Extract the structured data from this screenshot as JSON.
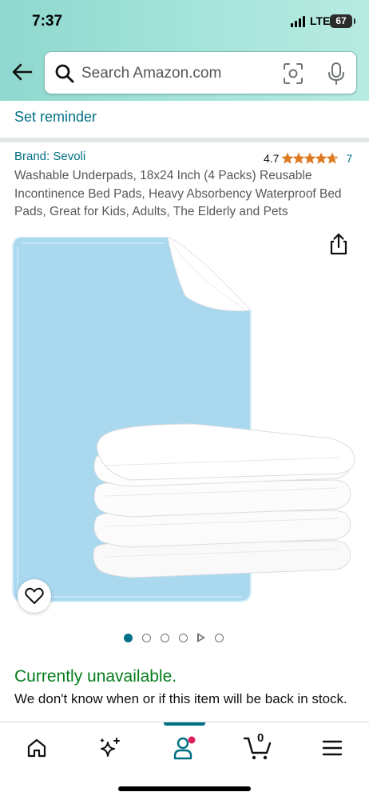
{
  "status_bar": {
    "time": "7:37",
    "network": "LTE",
    "battery": "67"
  },
  "header": {
    "search_placeholder": "Search Amazon.com",
    "icons": [
      "back-arrow-icon",
      "search-icon",
      "camera-scan-icon",
      "microphone-icon"
    ]
  },
  "reminder": {
    "label": "Set reminder"
  },
  "product": {
    "brand": "Brand: Sevoli",
    "rating": "4.7",
    "rating_value": 4.7,
    "rating_count": "7",
    "title": "Washable Underpads, 18x24 Inch (4 Packs) Reusable Incontinence Bed Pads, Heavy Absorbency Waterproof Bed Pads, Great for Kids, Adults, The Elderly and Pets"
  },
  "gallery": {
    "image_count": 6,
    "active_index": 0,
    "has_video": true
  },
  "availability": {
    "status": "Currently unavailable.",
    "note": "We don't know when or if this item will be back in stock."
  },
  "bottom_nav": {
    "items": [
      "home-icon",
      "sparkle-icon",
      "account-icon",
      "cart-icon",
      "menu-icon"
    ],
    "active": "account-icon",
    "cart_count": "0"
  },
  "colors": {
    "link": "#007185",
    "available_green": "#067d1d",
    "star": "#de7921",
    "header_bg": "#a3e3d9",
    "notification_dot": "#e01e5a"
  }
}
